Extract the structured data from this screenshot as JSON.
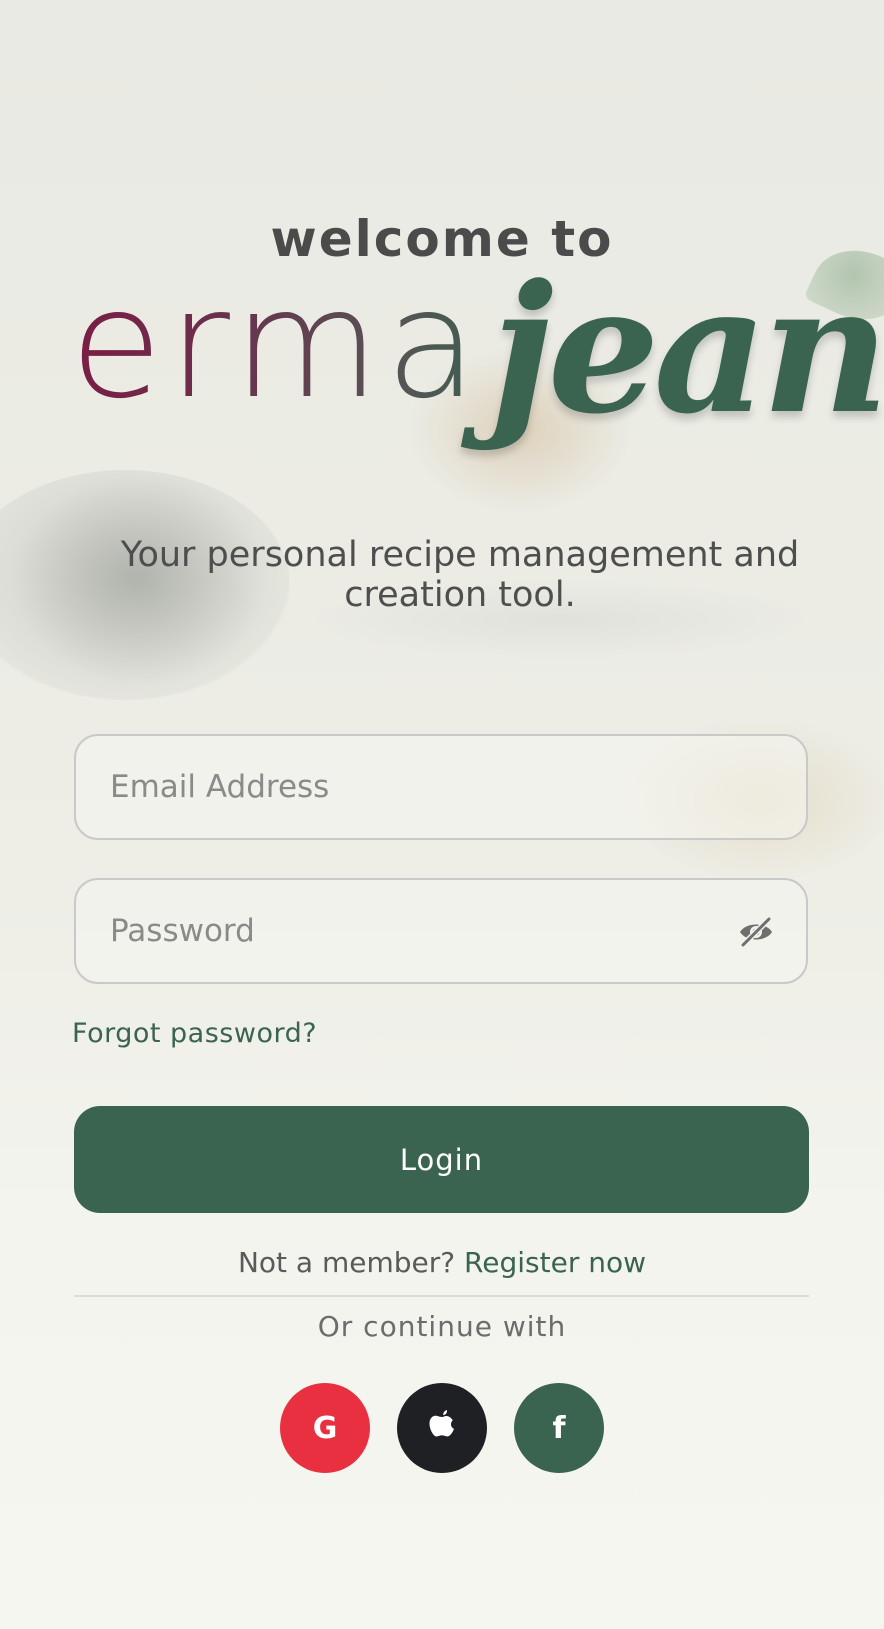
{
  "header": {
    "welcome": "welcome to",
    "logo_part1": "erma",
    "logo_part2": "jean",
    "tagline": "Your personal recipe management and creation tool."
  },
  "form": {
    "email_placeholder": "Email Address",
    "email_value": "",
    "password_placeholder": "Password",
    "password_value": "",
    "forgot_password": "Forgot password?",
    "login_label": "Login"
  },
  "register": {
    "prompt": "Not a member? ",
    "link": "Register now"
  },
  "social": {
    "divider_text": "Or continue with",
    "google_glyph": "G",
    "facebook_glyph": "f",
    "google_icon": "google-icon",
    "apple_icon": "apple-icon",
    "facebook_icon": "facebook-icon"
  },
  "colors": {
    "brand_green": "#3a6450",
    "logo_maroon": "#7a1d45",
    "google_red": "#e83040",
    "apple_black": "#1f2024",
    "background": "#f5f5ef"
  }
}
